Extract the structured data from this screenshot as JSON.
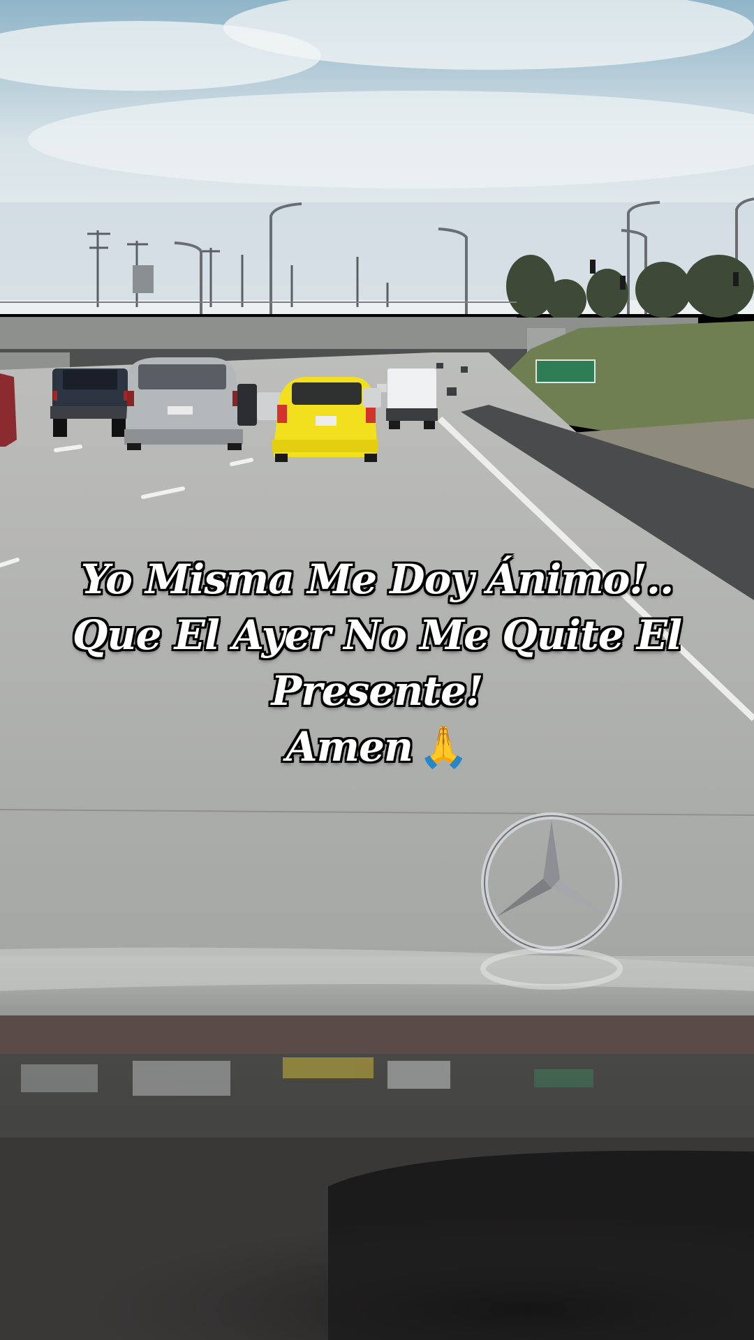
{
  "caption": {
    "line1": "Yo Misma Me Doy Ánimo!..",
    "line2": "Que El Ayer No Me Quite El",
    "line3": "Presente!",
    "line4": "Amen",
    "emoji": "🙏",
    "emoji_name": "praying-hands-icon"
  },
  "scene": {
    "description_colors": {
      "sky_top": "#8fb4c8",
      "sky_bottom": "#e6edf0",
      "road": "#a9abaa",
      "dashboard": "#1d1a1a",
      "taxi": "#f2df1e"
    }
  }
}
